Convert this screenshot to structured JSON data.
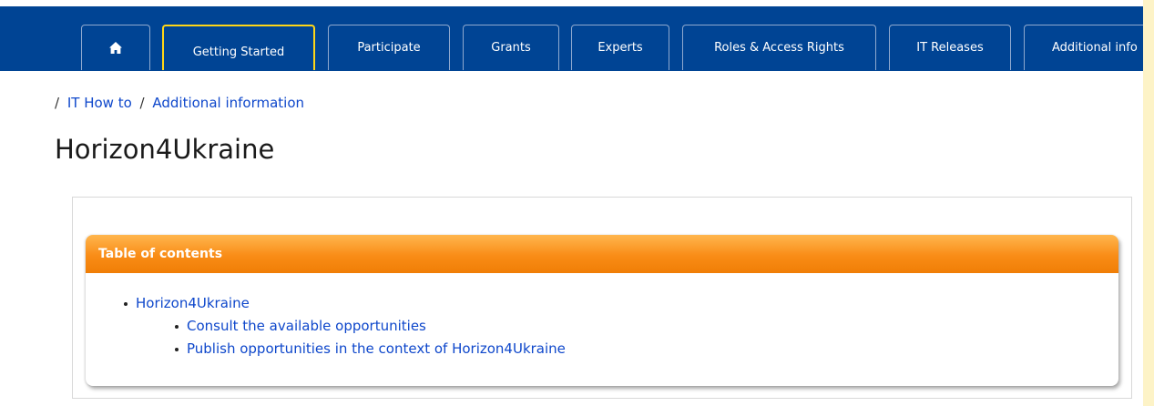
{
  "nav": {
    "home_icon": "home-icon",
    "items": [
      {
        "label": "Getting Started",
        "active": true
      },
      {
        "label": "Participate"
      },
      {
        "label": "Grants"
      },
      {
        "label": "Experts"
      },
      {
        "label": "Roles & Access Rights"
      },
      {
        "label": "IT Releases"
      },
      {
        "label": "Additional info"
      }
    ]
  },
  "breadcrumb": {
    "items": [
      "IT How to",
      "Additional information"
    ],
    "separator": "/"
  },
  "page_title": "Horizon4Ukraine",
  "toc": {
    "title": "Table of contents",
    "items": [
      {
        "label": "Horizon4Ukraine",
        "children": [
          {
            "label": "Consult the available opportunities"
          },
          {
            "label": "Publish opportunities in the context of Horizon4Ukraine"
          }
        ]
      }
    ]
  },
  "colors": {
    "nav_background": "#004494",
    "active_tab_border": "#ffd617",
    "link": "#0e47cb",
    "toc_header_top": "#ffb64e",
    "toc_header_bottom": "#f07e06",
    "outer_background": "#fdf3c7"
  }
}
